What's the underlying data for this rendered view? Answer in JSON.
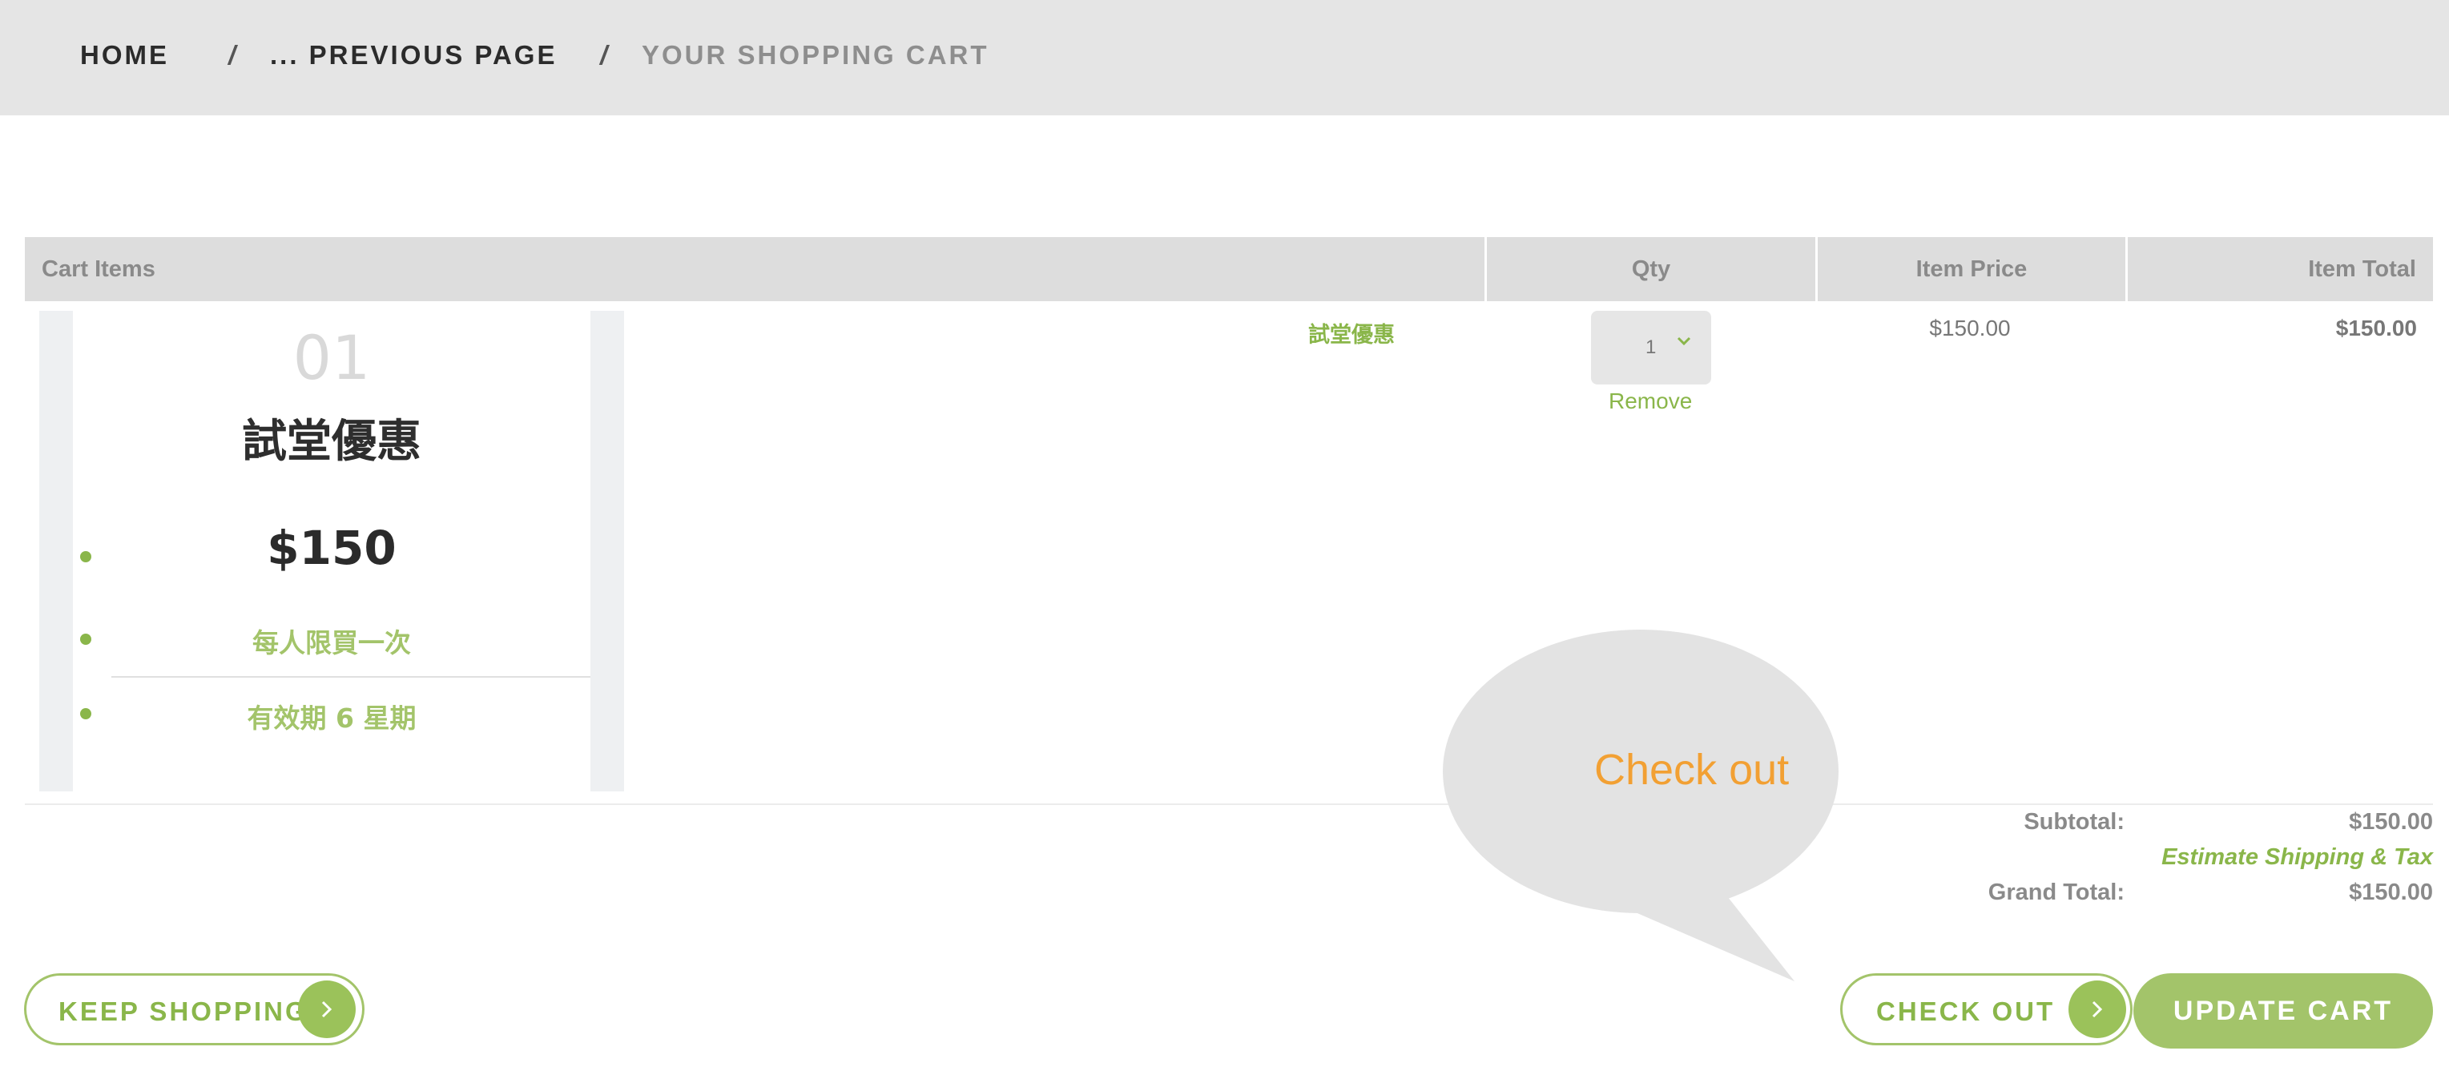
{
  "breadcrumb": {
    "home": "HOME",
    "previous": "... PREVIOUS PAGE",
    "current": "YOUR SHOPPING CART",
    "separator": "/"
  },
  "table": {
    "headers": {
      "items": "Cart Items",
      "qty": "Qty",
      "price": "Item Price",
      "total": "Item Total"
    },
    "rows": [
      {
        "image": {
          "number": "01",
          "title": "試堂優惠",
          "price": "$150",
          "line1": "每人限買一次",
          "line2": "有效期 6 星期"
        },
        "name": "試堂優惠",
        "qty": "1",
        "remove": "Remove",
        "price": "$150.00",
        "total": "$150.00"
      }
    ]
  },
  "summary": {
    "subtotal_label": "Subtotal:",
    "subtotal_value": "$150.00",
    "shipping_link": "Estimate Shipping & Tax",
    "grand_total_label": "Grand Total:",
    "grand_total_value": "$150.00"
  },
  "buttons": {
    "keep_shopping": "KEEP SHOPPING",
    "check_out": "CHECK OUT",
    "update_cart": "UPDATE CART"
  },
  "callout": {
    "text": "Check out"
  },
  "colors": {
    "accent": "#8ab64a",
    "accent_light": "#a3c46a",
    "header_bg": "#e5e5e5",
    "callout_bg": "#e3e3e3",
    "callout_text": "#f2a033"
  },
  "icons": {
    "button_arrow": "chevron-right-icon",
    "qty_dropdown": "chevron-down-icon",
    "list_marker": "bullet-icon"
  }
}
